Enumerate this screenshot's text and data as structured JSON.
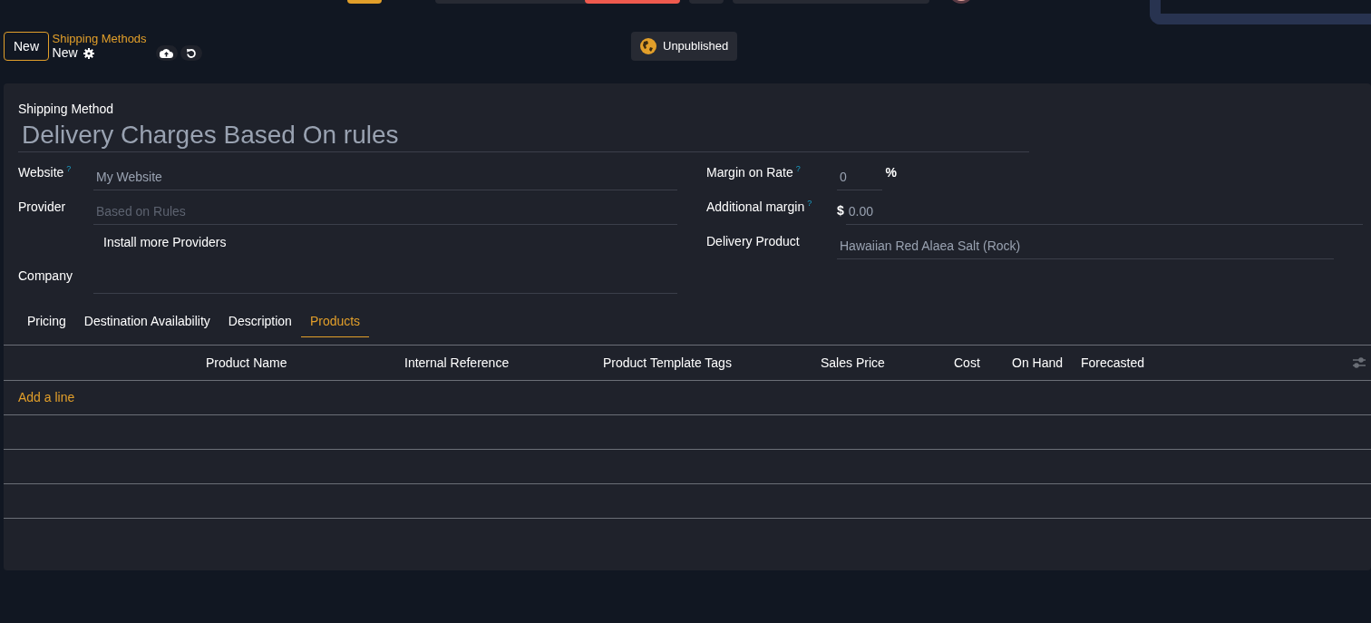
{
  "control_panel": {
    "new_button": "New",
    "breadcrumb": "Shipping Methods",
    "record_name": "New"
  },
  "website_status": {
    "label": "Unpublished"
  },
  "form": {
    "title_label": "Shipping Method",
    "title_value": "Delivery Charges Based On rules",
    "left_fields": [
      {
        "kind": "input",
        "label": "Website",
        "help": "?",
        "value": "My Website"
      },
      {
        "kind": "input",
        "label": "Provider",
        "placeholder": "Based on Rules"
      },
      {
        "kind": "button",
        "text": "Install more Providers"
      },
      {
        "kind": "input",
        "label": "Company"
      }
    ],
    "right_fields": [
      {
        "kind": "percent",
        "label": "Margin on Rate",
        "help": "?",
        "value": "0",
        "suffix": "%"
      },
      {
        "kind": "money",
        "label": "Additional margin",
        "help": "?",
        "prefix": "$",
        "value": "0.00"
      },
      {
        "kind": "input",
        "label": "Delivery Product",
        "value": "Hawaiian Red Alaea Salt (Rock)"
      }
    ]
  },
  "tabs": [
    {
      "label": "Pricing",
      "selected": false
    },
    {
      "label": "Destination Availability",
      "selected": false
    },
    {
      "label": "Description",
      "selected": false
    },
    {
      "label": "Products",
      "selected": true
    }
  ],
  "table": {
    "columns": [
      "Product Name",
      "Internal Reference",
      "Product Template Tags",
      "Sales Price",
      "Cost",
      "On Hand",
      "Forecasted"
    ],
    "add_line": "Add a line"
  }
}
